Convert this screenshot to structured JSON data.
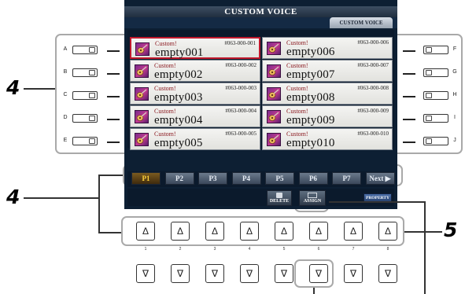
{
  "screen": {
    "title": "CUSTOM VOICE",
    "tab_label": "CUSTOM VOICE",
    "left_voices": [
      {
        "category": "Custom!",
        "number": "#063-000-001",
        "name": "empty001",
        "selected": true
      },
      {
        "category": "Custom!",
        "number": "#063-000-002",
        "name": "empty002",
        "selected": false
      },
      {
        "category": "Custom!",
        "number": "#063-000-003",
        "name": "empty003",
        "selected": false
      },
      {
        "category": "Custom!",
        "number": "#063-000-004",
        "name": "empty004",
        "selected": false
      },
      {
        "category": "Custom!",
        "number": "#063-000-005",
        "name": "empty005",
        "selected": false
      }
    ],
    "right_voices": [
      {
        "category": "Custom!",
        "number": "#063-000-006",
        "name": "empty006",
        "selected": false
      },
      {
        "category": "Custom!",
        "number": "#063-000-007",
        "name": "empty007",
        "selected": false
      },
      {
        "category": "Custom!",
        "number": "#063-000-008",
        "name": "empty008",
        "selected": false
      },
      {
        "category": "Custom!",
        "number": "#063-000-009",
        "name": "empty009",
        "selected": false
      },
      {
        "category": "Custom!",
        "number": "#063-000-010",
        "name": "empty010",
        "selected": false
      }
    ],
    "pages": [
      "P1",
      "P2",
      "P3",
      "P4",
      "P5",
      "P6",
      "P7",
      "Next ▶"
    ],
    "active_page": "P1",
    "actions": {
      "delete": "DELETE",
      "assign": "ASSIGN",
      "property": "PROPERTY"
    }
  },
  "side_buttons": {
    "left": [
      "A",
      "B",
      "C",
      "D",
      "E"
    ],
    "right": [
      "F",
      "G",
      "H",
      "I",
      "J"
    ]
  },
  "bottom_buttons": {
    "up_glyph": "Δ",
    "down_glyph": "∇",
    "numbers": [
      "1",
      "2",
      "3",
      "4",
      "5",
      "6",
      "7",
      "8"
    ]
  },
  "callouts": {
    "side_group": "4",
    "bottom_group": "4",
    "assign_group": "5"
  },
  "colors": {
    "screen_bg": "#0d1f33",
    "selected_border": "#c0182c",
    "active_page_text": "#ffd23a"
  },
  "icons": {
    "voice": "guitar-icon"
  }
}
